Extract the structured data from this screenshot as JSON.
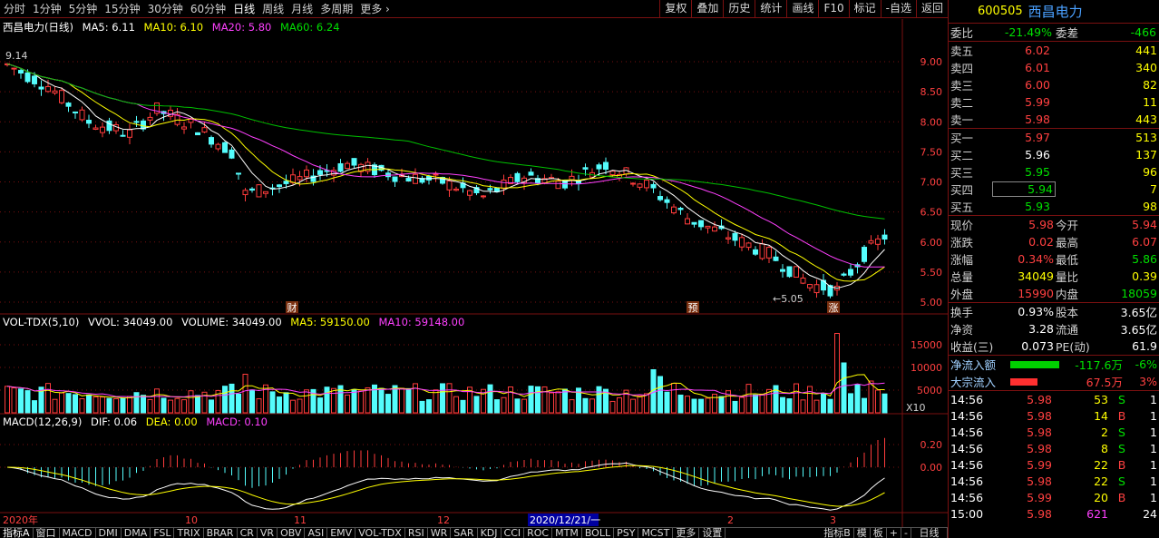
{
  "toolbar": {
    "periods": [
      "分时",
      "1分钟",
      "5分钟",
      "15分钟",
      "30分钟",
      "60分钟",
      "日线",
      "周线",
      "月线",
      "多周期",
      "更多"
    ],
    "more_arrow": "›",
    "buttons": [
      "复权",
      "叠加",
      "历史",
      "统计",
      "画线",
      "F10",
      "标记",
      "-自选",
      "返回"
    ]
  },
  "chart": {
    "main_legend": {
      "title": "西昌电力(日线)",
      "ma5": "MA5: 6.11",
      "ma10": "MA10: 6.10",
      "ma20": "MA20: 5.80",
      "ma60": "MA60: 6.24"
    },
    "vol_legend": {
      "title": "VOL-TDX(5,10)",
      "vvol": "VVOL: 34049.00",
      "volume": "VOLUME: 34049.00",
      "ma5": "MA5: 59150.00",
      "ma10": "MA10: 59148.00"
    },
    "macd_legend": {
      "title": "MACD(12,26,9)",
      "dif": "DIF: 0.06",
      "dea": "DEA: 0.00",
      "macd": "MACD: 0.10"
    },
    "price_ticks": [
      "9.00",
      "8.50",
      "8.00",
      "7.50",
      "7.00",
      "6.50",
      "6.00",
      "5.50",
      "5.00"
    ],
    "vol_ticks": [
      "15000",
      "10000",
      "5000"
    ],
    "vol_unit": "X10",
    "macd_ticks": [
      "0.20",
      "0.00"
    ],
    "high_label": "9.14",
    "low_label": "5.05",
    "markers": [
      "财",
      "预",
      "涨"
    ],
    "dates": [
      "2020年",
      "10",
      "11",
      "12",
      "2020/12/21/一",
      "2",
      "3"
    ],
    "colors": {
      "up": "#ff3c3c",
      "down": "#54fcfc",
      "ma5": "#ffffff",
      "ma10": "#ffff00",
      "ma20": "#ff40ff",
      "ma60": "#00c000",
      "grid": "#7a1010"
    }
  },
  "bottombar": {
    "tabs": [
      "指标A",
      "窗口",
      "MACD",
      "DMI",
      "DMA",
      "FSL",
      "TRIX",
      "BRAR",
      "CR",
      "VR",
      "OBV",
      "ASI",
      "EMV",
      "VOL-TDX",
      "RSI",
      "WR",
      "SAR",
      "KDJ",
      "CCI",
      "ROC",
      "MTM",
      "BOLL",
      "PSY",
      "MCST",
      "更多",
      "设置"
    ],
    "right": [
      "指标B",
      "模",
      "板",
      "+",
      "-"
    ],
    "period_label": "日线"
  },
  "panel": {
    "code": "600505",
    "name": "西昌电力",
    "weibi": {
      "label": "委比",
      "value": "-21.49%",
      "label2": "委差",
      "value2": "-466"
    },
    "asks": [
      {
        "label": "卖五",
        "price": "6.02",
        "vol": "441"
      },
      {
        "label": "卖四",
        "price": "6.01",
        "vol": "340"
      },
      {
        "label": "卖三",
        "price": "6.00",
        "vol": "82"
      },
      {
        "label": "卖二",
        "price": "5.99",
        "vol": "11"
      },
      {
        "label": "卖一",
        "price": "5.98",
        "vol": "443"
      }
    ],
    "bids": [
      {
        "label": "买一",
        "price": "5.97",
        "vol": "513"
      },
      {
        "label": "买二",
        "price": "5.96",
        "vol": "137"
      },
      {
        "label": "买三",
        "price": "5.95",
        "vol": "96"
      },
      {
        "label": "买四",
        "price": "5.94",
        "vol": "7"
      },
      {
        "label": "买五",
        "price": "5.93",
        "vol": "98"
      }
    ],
    "stats": [
      {
        "l1": "现价",
        "v1": "5.98",
        "l2": "今开",
        "v2": "5.94"
      },
      {
        "l1": "涨跌",
        "v1": "0.02",
        "l2": "最高",
        "v2": "6.07"
      },
      {
        "l1": "涨幅",
        "v1": "0.34%",
        "l2": "最低",
        "v2": "5.86"
      },
      {
        "l1": "总量",
        "v1": "34049",
        "l2": "量比",
        "v2": "0.39"
      },
      {
        "l1": "外盘",
        "v1": "15990",
        "l2": "内盘",
        "v2": "18059"
      }
    ],
    "stats2": [
      {
        "l1": "换手",
        "v1": "0.93%",
        "l2": "股本",
        "v2": "3.65亿"
      },
      {
        "l1": "净资",
        "v1": "3.28",
        "l2": "流通",
        "v2": "3.65亿"
      },
      {
        "l1": "收益(三)",
        "v1": "0.073",
        "l2": "PE(动)",
        "v2": "61.9"
      }
    ],
    "flow": [
      {
        "label": "净流入额",
        "value": "-117.6万",
        "pct": "-6%"
      },
      {
        "label": "大宗流入",
        "value": "67.5万",
        "pct": "3%"
      }
    ],
    "ticks": [
      {
        "time": "14:56",
        "price": "5.98",
        "vol": "53",
        "side": "S",
        "n": "1"
      },
      {
        "time": "14:56",
        "price": "5.98",
        "vol": "14",
        "side": "B",
        "n": "1"
      },
      {
        "time": "14:56",
        "price": "5.98",
        "vol": "2",
        "side": "S",
        "n": "1"
      },
      {
        "time": "14:56",
        "price": "5.98",
        "vol": "8",
        "side": "S",
        "n": "1"
      },
      {
        "time": "14:56",
        "price": "5.99",
        "vol": "22",
        "side": "B",
        "n": "1"
      },
      {
        "time": "14:56",
        "price": "5.98",
        "vol": "22",
        "side": "S",
        "n": "1"
      },
      {
        "time": "14:56",
        "price": "5.99",
        "vol": "20",
        "side": "B",
        "n": "1"
      },
      {
        "time": "15:00",
        "price": "5.98",
        "vol": "621",
        "side": "",
        "n": "24"
      }
    ]
  }
}
